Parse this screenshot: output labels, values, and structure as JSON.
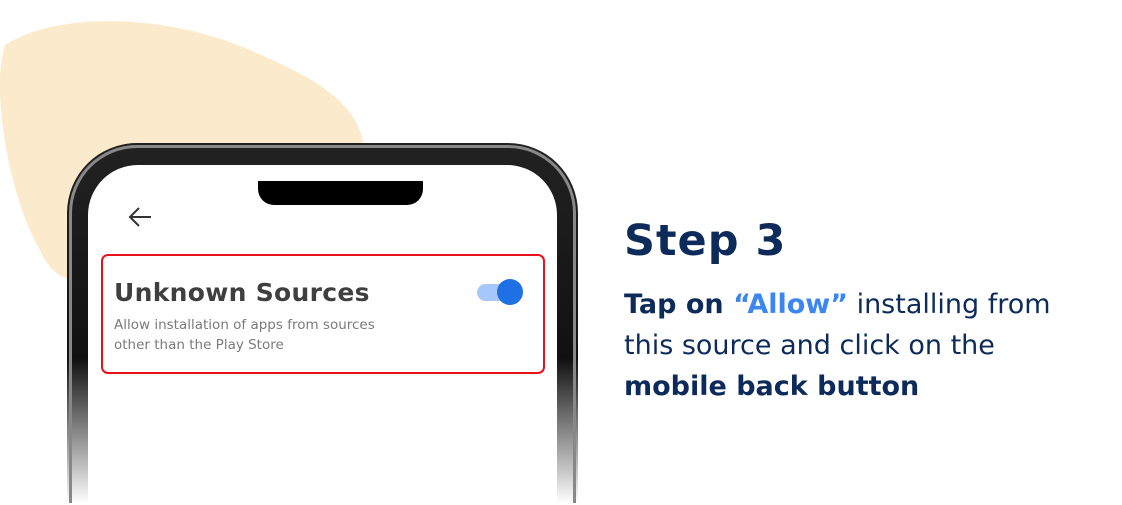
{
  "colors": {
    "accent": "#3b86f0",
    "heading": "#0d2b5a",
    "highlight_border": "#e8101a",
    "blob": "#fbebcc",
    "toggle_on": "#1f6fe5"
  },
  "phone": {
    "back_icon": "arrow-left-icon",
    "setting": {
      "title": "Unknown Sources",
      "description": "Allow installation of apps from sources other than the Play Store",
      "toggle_on": true
    }
  },
  "instruction": {
    "step": "Step 3",
    "part1": "Tap on ",
    "allow": "“Allow”",
    "part2": " installing from this source and click on the ",
    "part3": "mobile back button"
  }
}
